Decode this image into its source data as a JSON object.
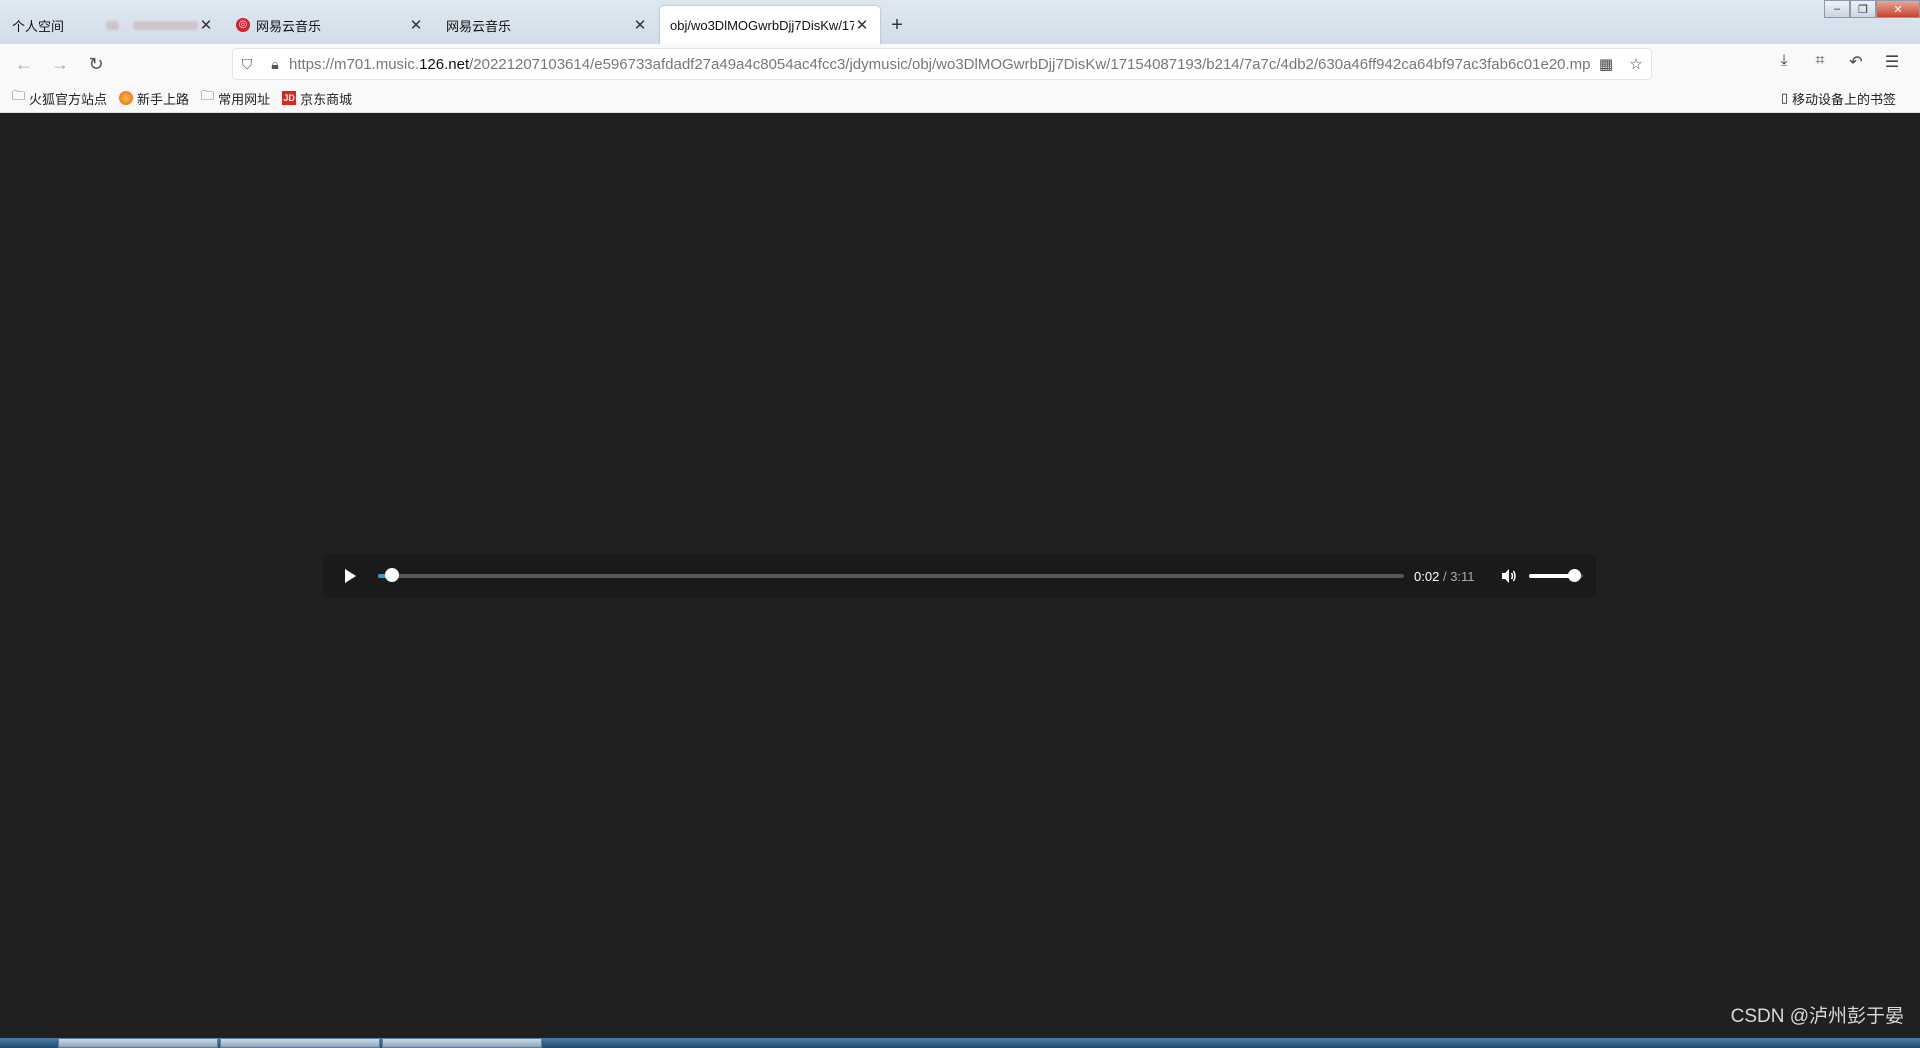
{
  "tabs": [
    {
      "title": "个人空间",
      "icon": "blank-icon",
      "closable": false
    },
    {
      "title": "",
      "icon": "blurred-favicon",
      "closable": true
    },
    {
      "title": "网易云音乐",
      "icon": "netease-music-icon",
      "closable": true
    },
    {
      "title": "网易云音乐",
      "icon": "none",
      "closable": true
    },
    {
      "title": "obj/wo3DlMOGwrbDjj7DisKw/17",
      "icon": "none",
      "closable": true,
      "active": true
    }
  ],
  "address": {
    "prefix": "https://m701.music.",
    "domain": "126.net",
    "path": "/20221207103614/e596733afdadf27a49a4c8054ac4fcc3/jdymusic/obj/wo3DlMOGwrbDjj7DisKw/17154087193/b214/7a7c/4db2/630a46ff942ca64bf97ac3fab6c01e20.mp"
  },
  "bookmarks": [
    {
      "label": "火狐官方站点",
      "icon": "folder-icon"
    },
    {
      "label": "新手上路",
      "icon": "firefox-icon"
    },
    {
      "label": "常用网址",
      "icon": "folder-icon"
    },
    {
      "label": "京东商城",
      "icon": "jd-icon"
    }
  ],
  "mobile_bookmarks": "移动设备上的书签",
  "player": {
    "current_time": "0:02",
    "separator": "/",
    "duration": "3:11",
    "progress_fraction": 0.014,
    "volume_fraction": 0.85,
    "state": "paused"
  },
  "watermark": "CSDN @泸州彭于晏",
  "colors": {
    "progress": "#2f9fe0",
    "background": "#202020"
  }
}
